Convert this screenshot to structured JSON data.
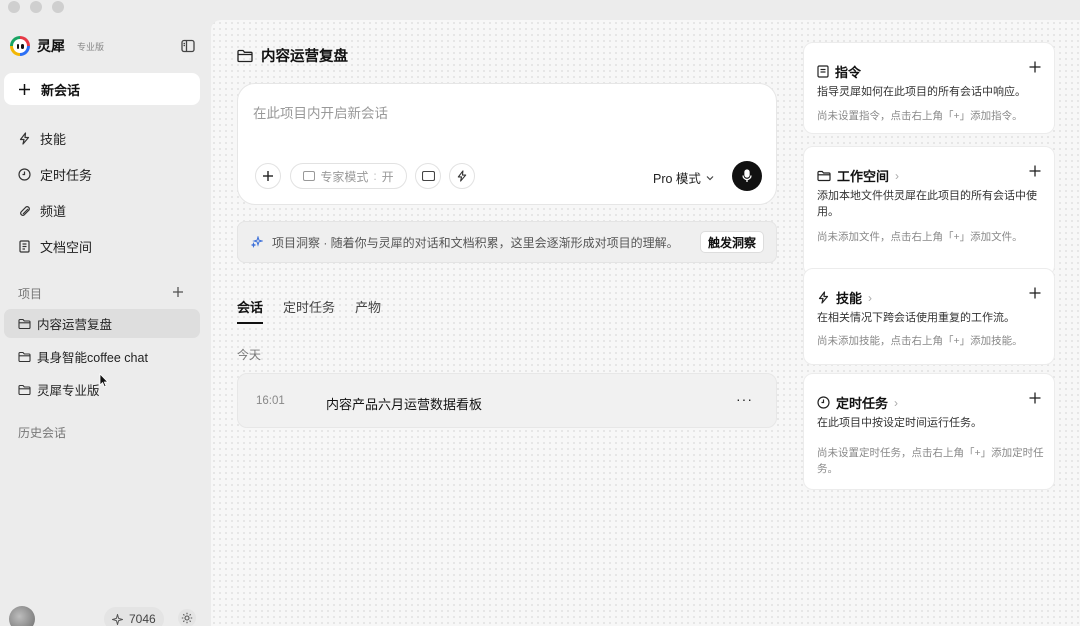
{
  "brand": {
    "name": "灵犀",
    "tag": "专业版"
  },
  "sidebar": {
    "new_chat": "新会话",
    "nav": [
      {
        "label": "技能",
        "icon": "bolt-icon"
      },
      {
        "label": "定时任务",
        "icon": "clock-icon"
      },
      {
        "label": "频道",
        "icon": "channel-icon"
      },
      {
        "label": "文档空间",
        "icon": "document-icon"
      }
    ],
    "projects_label": "项目",
    "projects": [
      {
        "label": "内容运营复盘",
        "active": true
      },
      {
        "label": "具身智能coffee chat",
        "active": false
      },
      {
        "label": "灵犀专业版",
        "active": false
      }
    ],
    "history_label": "历史会话",
    "credits": "7046"
  },
  "main": {
    "title": "内容运营复盘",
    "composer": {
      "placeholder": "在此项目内开启新会话",
      "expert_mode": "专家模式",
      "expert_toggle": "开",
      "mode": "Pro 模式"
    },
    "insight": {
      "text": "项目洞察 · 随着你与灵犀的对话和文档积累，这里会逐渐形成对项目的理解。",
      "button": "触发洞察"
    },
    "tabs": [
      "会话",
      "定时任务",
      "产物"
    ],
    "day_label": "今天",
    "sessions": [
      {
        "time": "16:01",
        "title": "内容产品六月运营数据看板",
        "more": "···"
      }
    ]
  },
  "cards": [
    {
      "title": "指令",
      "icon": "instruction-icon",
      "chevron": false,
      "desc": "指导灵犀如何在此项目的所有会话中响应。",
      "empty": "尚未设置指令，点击右上角「+」添加指令。"
    },
    {
      "title": "工作空间",
      "icon": "folder-icon",
      "chevron": true,
      "desc": "添加本地文件供灵犀在此项目的所有会话中使用。",
      "empty": "尚未添加文件，点击右上角「+」添加文件。"
    },
    {
      "title": "技能",
      "icon": "bolt-icon",
      "chevron": true,
      "desc": "在相关情况下跨会话使用重复的工作流。",
      "empty": "尚未添加技能，点击右上角「+」添加技能。"
    },
    {
      "title": "定时任务",
      "icon": "clock-icon",
      "chevron": true,
      "desc": "在此项目中按设定时间运行任务。",
      "empty": "尚未设置定时任务，点击右上角「+」添加定时任务。"
    }
  ]
}
